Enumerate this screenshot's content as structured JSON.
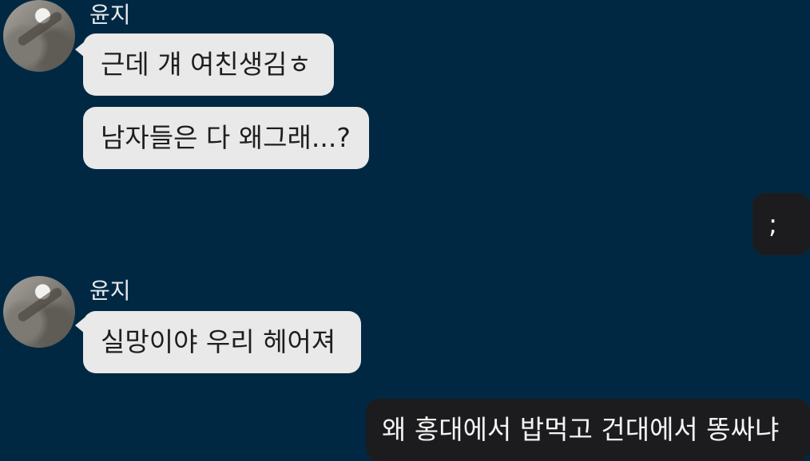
{
  "chat": {
    "messages": [
      {
        "sender": "윤지",
        "text": "근데 걔 여친생김ㅎ"
      },
      {
        "sender": "윤지",
        "text": "남자들은 다 왜그래...?"
      },
      {
        "sender": "me",
        "text": ";"
      },
      {
        "sender": "윤지",
        "text": "실망이야 우리 헤어져"
      },
      {
        "sender": "me",
        "text": "왜 홍대에서 밥먹고 건대에서 똥싸냐"
      }
    ]
  },
  "colors": {
    "background": "#012843",
    "incoming_bubble": "#e9e9e9",
    "outgoing_bubble": "#1c1c1e"
  }
}
